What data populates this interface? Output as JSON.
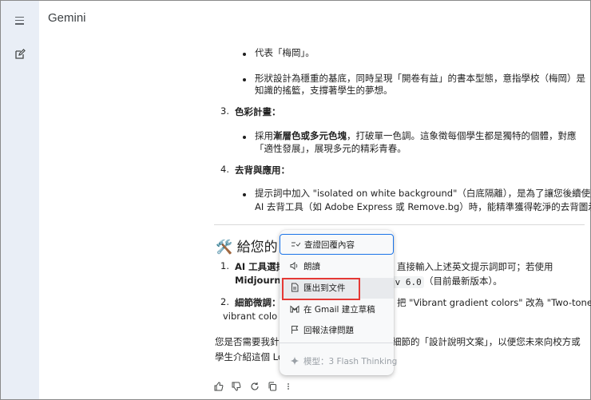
{
  "app": {
    "title": "Gemini"
  },
  "content": {
    "b1": "代表「梅岡」。",
    "b2_l1": "形狀設計為穩重的基底，同時呈現「開卷有益」的書本型態，意指學校（梅岡）是",
    "b2_l2": "知識的搖籃，支撐著學生的夢想。",
    "n3": "3.",
    "n3_title": "色彩計畫：",
    "b3_l1_pre": "採用",
    "b3_l1_bold": "漸層色或多元色塊",
    "b3_l1_post": "，打破單一色調。這象徵每個學生都是獨特的個體，對應",
    "b3_l2": "「適性發展」，展現多元的精彩青春。",
    "n4": "4.",
    "n4_title": "去背與應用：",
    "b4_l1": "提示詞中加入 \"isolated on white background\"（白底隔離），是為了讓您後續使用",
    "b4_l2": "AI 去背工具（如 Adobe Express 或 Remove.bg）時，能精準獲得乾淨的去背圖示。",
    "h2_icon": "🛠️",
    "h2_text": "給您的",
    "n1": "1.",
    "s1_l1_bold": "AI 工具選擇",
    "s1_l1_right": "直接輸入上述英文提示詞即可；若使用",
    "s1_l2_bold": "Midjourney",
    "s1_l2_code": "-v 6.0",
    "s1_l2_right": "（目前最新版本）。",
    "n2": "2.",
    "s2_l1_bold": "細節微調：",
    "s2_l1_right": "把 \"Vibrant gradient colors\" 改為 \"Two-tone",
    "s2_l2": "vibrant colo",
    "closing_l1_left": "您是否需要我針",
    "closing_l1_right": "細節的「設計說明文案」，以便您未來向校方或",
    "closing_l2": "學生介紹這個 Lo"
  },
  "context_menu": {
    "items": [
      {
        "label": "查證回覆內容",
        "icon": "double-check-icon"
      },
      {
        "label": "朗讀",
        "icon": "speaker-icon"
      },
      {
        "label": "匯出到文件",
        "icon": "document-icon"
      },
      {
        "label": "在 Gmail 建立草稿",
        "icon": "gmail-icon"
      },
      {
        "label": "回報法律問題",
        "icon": "flag-icon"
      }
    ],
    "model_label": "模型：3 Flash Thinking"
  },
  "colors": {
    "rail": "#e9eef6",
    "accent": "#1a73e8",
    "highlight_box": "#e53935"
  }
}
